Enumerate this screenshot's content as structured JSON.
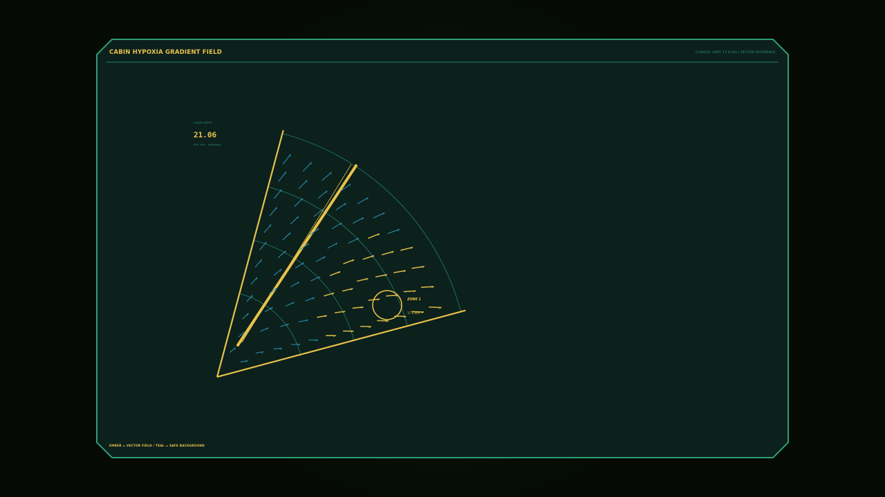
{
  "header": {
    "title": "CABIN HYPOXIA GRADIENT FIELD",
    "subtitle": "CLINICAL LIMIT 17.0 kPa / VECTOR REFERENCE"
  },
  "readout": {
    "label": "CABIN INDEX",
    "value": "21.06",
    "sub": "PO2 kPa · NOMINAL"
  },
  "zone": {
    "label": "ZONE 1",
    "value": "17.0 kPa"
  },
  "footer": {
    "legend": "EMBER = VECTOR FIELD  /  TEAL = SAFE BACKGROUND"
  },
  "colors": {
    "frame": "#2f9e78",
    "panel": "#0c201c",
    "ember": "#e8c24a",
    "vector": "#2b8fb0",
    "grid": "#1f7a5e"
  }
}
